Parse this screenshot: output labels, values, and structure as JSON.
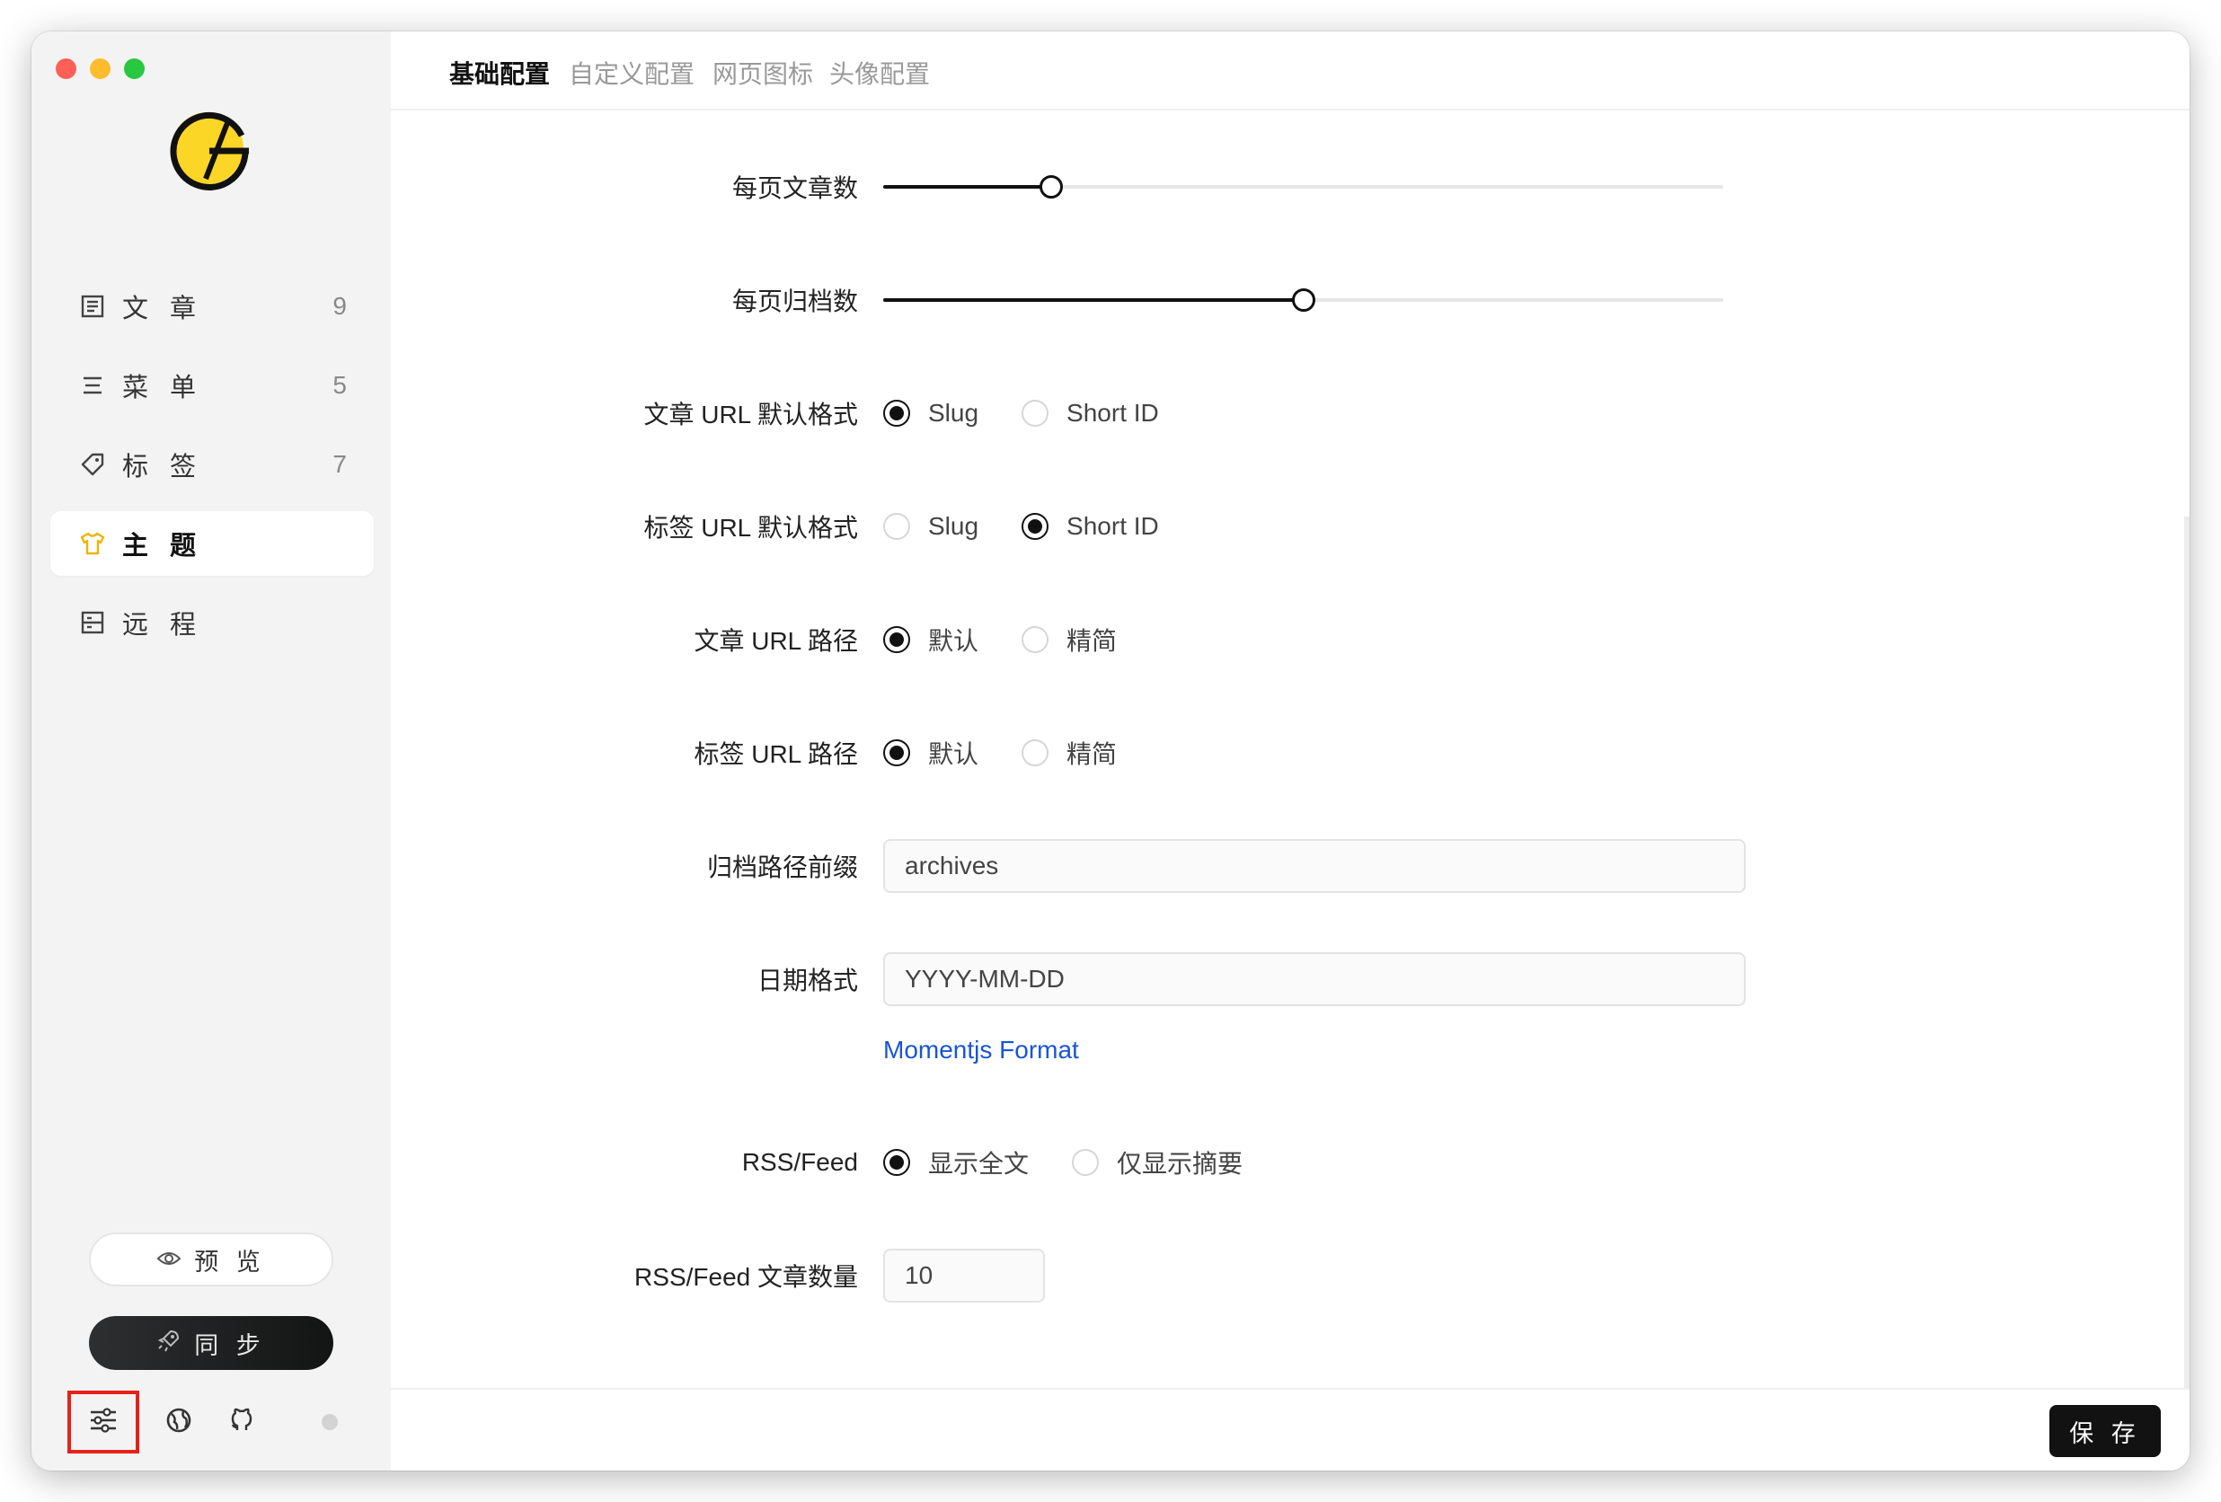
{
  "window": {
    "traffic_lights": [
      "close",
      "minimize",
      "zoom"
    ]
  },
  "sidebar": {
    "logo": "gridea-logo",
    "items": [
      {
        "label": "文 章",
        "count": "9",
        "icon": "article-icon"
      },
      {
        "label": "菜 单",
        "count": "5",
        "icon": "menu-icon"
      },
      {
        "label": "标 签",
        "count": "7",
        "icon": "tag-icon"
      },
      {
        "label": "主 题",
        "count": "",
        "icon": "shirt-icon",
        "active": true
      },
      {
        "label": "远 程",
        "count": "",
        "icon": "remote-icon"
      }
    ],
    "preview_label": "预 览",
    "sync_label": "同 步",
    "bottom_icons": [
      "settings-icon",
      "globe-icon",
      "github-icon",
      "status-dot"
    ]
  },
  "tabs": [
    {
      "label": "基础配置",
      "active": true
    },
    {
      "label": "自定义配置"
    },
    {
      "label": "网页图标"
    },
    {
      "label": "头像配置"
    }
  ],
  "form": {
    "posts_per_page": {
      "label": "每页文章数",
      "value_fraction": 0.2
    },
    "archives_per_page": {
      "label": "每页归档数",
      "value_fraction": 0.5
    },
    "post_url_format": {
      "label": "文章 URL 默认格式",
      "options": [
        "Slug",
        "Short ID"
      ],
      "selected": "Slug"
    },
    "tag_url_format": {
      "label": "标签 URL 默认格式",
      "options": [
        "Slug",
        "Short ID"
      ],
      "selected": "Short ID"
    },
    "post_url_path": {
      "label": "文章 URL 路径",
      "options": [
        "默认",
        "精简"
      ],
      "selected": "默认"
    },
    "tag_url_path": {
      "label": "标签 URL 路径",
      "options": [
        "默认",
        "精简"
      ],
      "selected": "默认"
    },
    "archives_prefix": {
      "label": "归档路径前缀",
      "value": "archives"
    },
    "date_format": {
      "label": "日期格式",
      "value": "YYYY-MM-DD",
      "link": "Momentjs Format"
    },
    "rss_mode": {
      "label": "RSS/Feed",
      "options": [
        "显示全文",
        "仅显示摘要"
      ],
      "selected": "显示全文"
    },
    "rss_count": {
      "label": "RSS/Feed 文章数量",
      "value": "10"
    }
  },
  "footer": {
    "save_label": "保 存"
  },
  "colors": {
    "accent": "#111111",
    "link": "#1a55d6",
    "highlight_box": "#e8201a",
    "logo_yellow": "#fcd626"
  }
}
